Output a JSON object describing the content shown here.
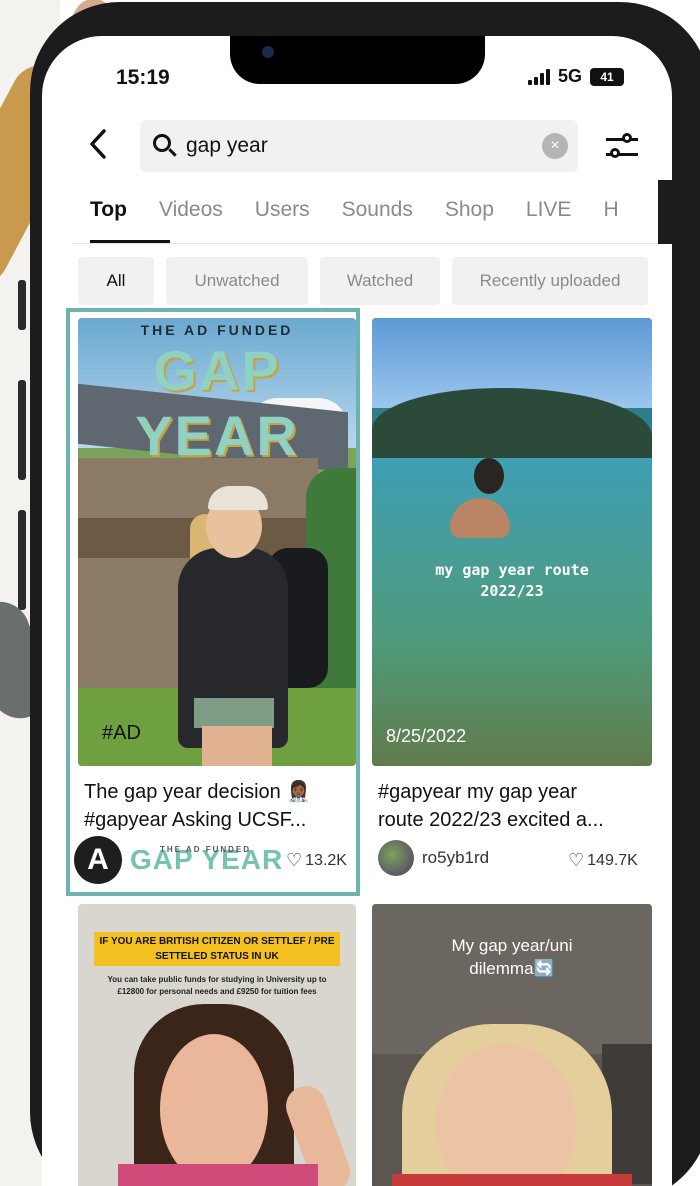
{
  "status_bar": {
    "time": "15:19",
    "network": "5G",
    "battery": "41"
  },
  "search": {
    "query": "gap year",
    "clear_glyph": "×",
    "back_glyph": "‹"
  },
  "tabs": [
    {
      "label": "Top",
      "active": true
    },
    {
      "label": "Videos"
    },
    {
      "label": "Users"
    },
    {
      "label": "Sounds"
    },
    {
      "label": "Shop"
    },
    {
      "label": "LIVE"
    },
    {
      "label": "H"
    }
  ],
  "chips": [
    {
      "label": "All",
      "active": true
    },
    {
      "label": "Unwatched"
    },
    {
      "label": "Watched"
    },
    {
      "label": "Recently uploaded"
    }
  ],
  "results": [
    {
      "thumb_title_small": "THE AD FUNDED",
      "thumb_title_big": "GAP YEAR",
      "overlay_text": "#AD",
      "caption_line1": "The gap year decision 👩🏾‍⚕️",
      "caption_line2": "#gapyear Asking UCSF...",
      "author_avatar_letter": "A",
      "author_brand_small": "THE AD FUNDED",
      "author_brand": "GAP YEAR",
      "likes": "13.2K"
    },
    {
      "overlay_line1": "my gap year route",
      "overlay_line2": "2022/23",
      "overlay_date": "8/25/2022",
      "caption_line1": "#gapyear my gap year",
      "caption_line2": "route 2022/23 excited a...",
      "author": "ro5yb1rd",
      "likes": "149.7K"
    },
    {
      "banner": "IF YOU ARE BRITISH CITIZEN OR SETTLEF / PRE SETTELED STATUS IN UK",
      "sub": "You can take public funds for studying in University up to £12800 for personal needs and £9250 for tuition fees"
    },
    {
      "overlay_line1": "My gap year/uni",
      "overlay_line2": "dilemma🔄"
    }
  ],
  "colors": {
    "highlight": "#6fb3b1",
    "brand_teal": "#76c2b4"
  },
  "icons": {
    "heart": "♡"
  }
}
